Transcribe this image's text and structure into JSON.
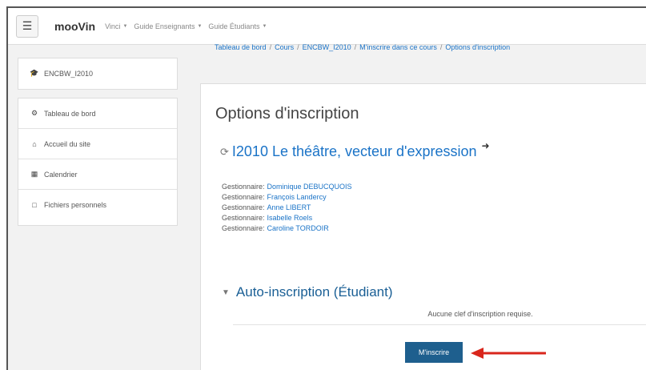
{
  "navbar": {
    "menu_icon": "hamburger-icon",
    "brand": "mooVin",
    "menus": [
      {
        "label": "Vinci"
      },
      {
        "label": "Guide Enseignants"
      },
      {
        "label": "Guide Étudiants"
      }
    ]
  },
  "sidebar": {
    "course": {
      "icon": "graduation-cap-icon",
      "label": "ENCBW_I2010"
    },
    "items": [
      {
        "icon": "dashboard-icon",
        "label": "Tableau de bord"
      },
      {
        "icon": "home-icon",
        "label": "Accueil du site"
      },
      {
        "icon": "calendar-icon",
        "label": "Calendrier"
      },
      {
        "icon": "file-icon",
        "label": "Fichiers personnels"
      }
    ]
  },
  "breadcrumb": [
    "Tableau de bord",
    "Cours",
    "ENCBW_I2010",
    "M'inscrire dans ce cours",
    "Options d'inscription"
  ],
  "main": {
    "title": "Options d'inscription",
    "course_name": "I2010 Le théâtre, vecteur d'expression",
    "managers": [
      {
        "role": "Gestionnaire:",
        "name": "Dominique DEBUCQUOIS"
      },
      {
        "role": "Gestionnaire:",
        "name": "François Landercy"
      },
      {
        "role": "Gestionnaire:",
        "name": "Anne LIBERT"
      },
      {
        "role": "Gestionnaire:",
        "name": "Isabelle Roels"
      },
      {
        "role": "Gestionnaire:",
        "name": "Caroline TORDOIR"
      }
    ],
    "section_title": "Auto-inscription (Étudiant)",
    "key_note": "Aucune clef d'inscription requise.",
    "enroll_button": "M'inscrire"
  },
  "colors": {
    "link": "#1a73c7",
    "button": "#1e5f8e",
    "arrow": "#d9261c"
  }
}
